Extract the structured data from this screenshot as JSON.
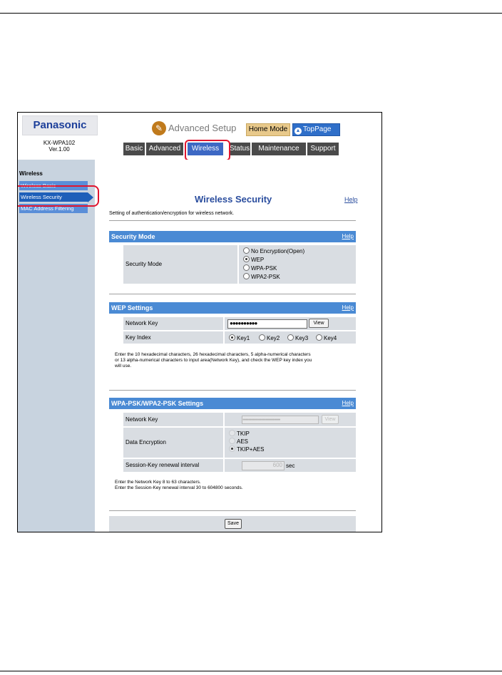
{
  "header": {
    "brand": "Panasonic",
    "model": "KX-WPA102",
    "version": "Ver.1.00",
    "advanced_setup": "Advanced Setup",
    "home_mode": "Home Mode",
    "top_page": "TopPage",
    "tabs": [
      {
        "label": "Basic"
      },
      {
        "label": "Advanced"
      },
      {
        "label": "Wireless"
      },
      {
        "label": "Status"
      },
      {
        "label": "Maintenance"
      },
      {
        "label": "Support"
      }
    ],
    "active_tab": "Wireless"
  },
  "sidebar": {
    "title": "Wireless",
    "items": [
      {
        "label": "Wireless Basic"
      },
      {
        "label": "Wireless Security"
      },
      {
        "label": "MAC Address Filtering"
      }
    ],
    "selected": "Wireless Security"
  },
  "main": {
    "title": "Wireless Security",
    "help": "Help",
    "description": "Setting of authentication/encryption for wireless network.",
    "security_mode": {
      "header": "Security Mode",
      "help": "Help",
      "label": "Security Mode",
      "options": [
        "No Encryption(Open)",
        "WEP",
        "WPA-PSK",
        "WPA2-PSK"
      ],
      "selected": "WEP"
    },
    "wep": {
      "header": "WEP Settings",
      "help": "Help",
      "network_key_label": "Network Key",
      "network_key_value": "●●●●●●●●●●",
      "view_button": "View",
      "key_index_label": "Key Index",
      "key_options": [
        "Key1",
        "Key2",
        "Key3",
        "Key4"
      ],
      "selected_key": "Key1",
      "note_line1": "Enter the 10 hexadecimal characters, 26 hexadecimal characters, 5 alpha-numerical characters",
      "note_line2": "or 13 alpha-numerical characters to input area(Network Key), and check the WEP key index you",
      "note_line3": "will use."
    },
    "wpa": {
      "header": "WPA-PSK/WPA2-PSK Settings",
      "help": "Help",
      "network_key_label": "Network Key",
      "network_key_value": "●●●●●●●●●●●●●●●●●●●●●●●●●●",
      "view_button": "View",
      "data_encryption_label": "Data Encryption",
      "encryption_options": [
        "TKIP",
        "AES",
        "TKIP+AES"
      ],
      "session_label": "Session-Key renewal interval",
      "session_value": "600",
      "session_unit": "sec",
      "note_line1": "Enter the Network Key 8 to 63 characters.",
      "note_line2": "Enter the Session-Key renewal interval 30 to 604800 seconds."
    },
    "save_button": "Save"
  },
  "colors": {
    "accent_blue": "#4a8ad4",
    "highlight_red": "#e0152f",
    "sidebar_bg": "#c8d3df"
  }
}
